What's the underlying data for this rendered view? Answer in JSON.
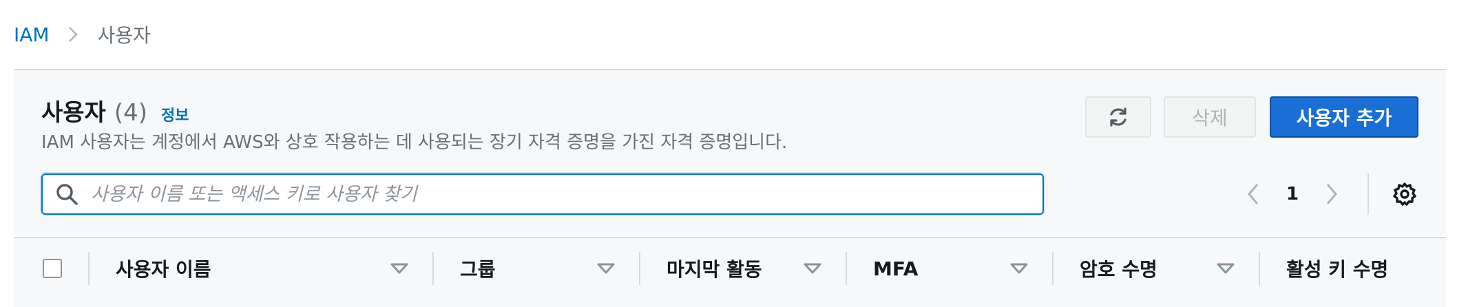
{
  "breadcrumb": {
    "root": "IAM",
    "current": "사용자"
  },
  "header": {
    "title": "사용자",
    "count": "(4)",
    "info": "정보",
    "description": "IAM 사용자는 계정에서 AWS와 상호 작용하는 데 사용되는 장기 자격 증명을 가진 자격 증명입니다."
  },
  "actions": {
    "refresh_icon": "refresh-icon",
    "delete_label": "삭제",
    "add_user_label": "사용자 추가"
  },
  "search": {
    "placeholder": "사용자 이름 또는 액세스 키로 사용자 찾기",
    "value": ""
  },
  "pagination": {
    "current_page": "1"
  },
  "table": {
    "columns": [
      {
        "label": "사용자 이름"
      },
      {
        "label": "그룹"
      },
      {
        "label": "마지막 활동"
      },
      {
        "label": "MFA"
      },
      {
        "label": "암호 수명"
      },
      {
        "label": "활성 키 수명"
      }
    ]
  },
  "colors": {
    "accent": "#0073bb",
    "primary_button": "#1a6fd6",
    "muted_text": "#687078"
  }
}
